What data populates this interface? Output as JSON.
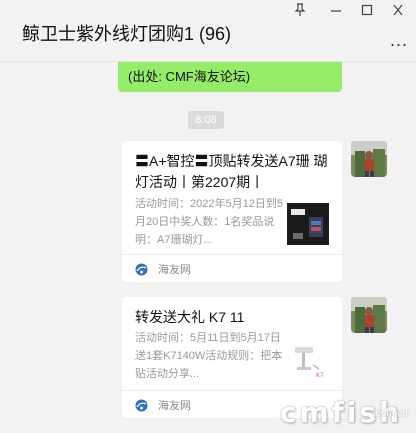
{
  "window": {
    "title": "鲸卫士紫外线灯团购1 (96)",
    "more_label": "...",
    "pin_icon": "pin-icon",
    "minimize_icon": "minimize-icon",
    "maximize_icon": "maximize-icon",
    "close_icon": "close-icon"
  },
  "messages": {
    "prev_bubble_text": "(出处: CMF海友论坛)",
    "timestamp": "8:08",
    "cards": [
      {
        "title": "〓A+智控〓顶贴转发送A7珊 瑚灯活动丨第2207期丨",
        "description": "活动时间：2022年5月12日到5月20日中奖人数：1名奖品说明：A7珊瑚灯...",
        "source": "海友网"
      },
      {
        "title": "转发送大礼 K7 11",
        "description": "活动时间：5月11日到5月17日送1套K7140W活动规则：把本贴活动分享...",
        "source": "海友网"
      }
    ]
  },
  "watermark": {
    "text": "cmfish",
    "sub": ".com.cn"
  },
  "colors": {
    "bubble_green": "#95ec69",
    "background": "#f2f2f2"
  }
}
